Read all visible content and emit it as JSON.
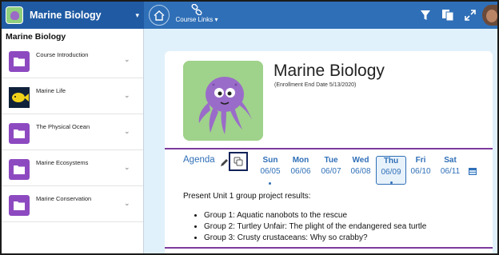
{
  "header": {
    "course_name": "Marine Biology",
    "course_caret": "▾",
    "links_label": "Course Links ▾",
    "accent": "#2f6fb7"
  },
  "sidebar": {
    "title": "Marine Biology",
    "items": [
      {
        "label": "Course Introduction",
        "thumb": "folder-icon"
      },
      {
        "label": "Marine Life",
        "thumb": "fish-photo"
      },
      {
        "label": "The Physical Ocean",
        "thumb": "folder-icon"
      },
      {
        "label": "Marine Ecosystems",
        "thumb": "folder-icon"
      },
      {
        "label": "Marine Conservation",
        "thumb": "folder-icon"
      }
    ],
    "chevron": "⌄"
  },
  "main": {
    "title": "Marine Biology",
    "enrollment": "(Enrollment End Date 5/13/2020)",
    "agenda_label": "Agenda",
    "days": [
      {
        "name": "Sun",
        "date": "06/05",
        "dot": true,
        "selected": false
      },
      {
        "name": "Mon",
        "date": "06/06",
        "dot": false,
        "selected": false
      },
      {
        "name": "Tue",
        "date": "06/07",
        "dot": false,
        "selected": false
      },
      {
        "name": "Wed",
        "date": "06/08",
        "dot": false,
        "selected": false
      },
      {
        "name": "Thu",
        "date": "06/09",
        "dot": true,
        "selected": true
      },
      {
        "name": "Fri",
        "date": "06/10",
        "dot": false,
        "selected": false
      },
      {
        "name": "Sat",
        "date": "06/11",
        "dot": false,
        "selected": false
      }
    ],
    "agenda_intro": "Present Unit 1 group project results:",
    "agenda_items": [
      "Group 1: Aquatic nanobots to the rescue",
      "Group 2: Turtley Unfair: The plight of the endangered sea turtle",
      "Group 3: Crusty crustaceans: Why so crabby?"
    ],
    "divider_color": "#7b3b9c"
  }
}
